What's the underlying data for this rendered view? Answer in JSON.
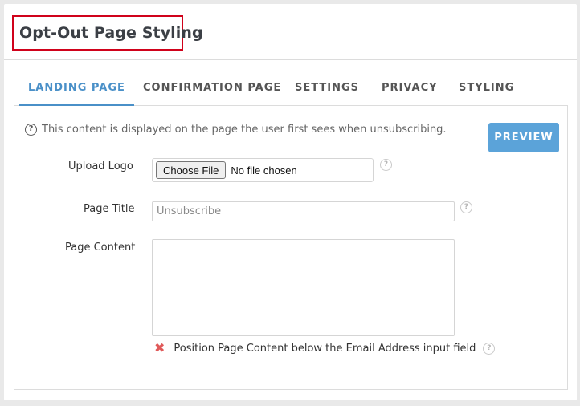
{
  "page": {
    "title": "Opt-Out Page Styling"
  },
  "tabs": [
    {
      "label": "LANDING PAGE",
      "active": true
    },
    {
      "label": "CONFIRMATION PAGE",
      "active": false
    },
    {
      "label": "SETTINGS",
      "active": false
    },
    {
      "label": "PRIVACY",
      "active": false
    },
    {
      "label": "STYLING",
      "active": false
    }
  ],
  "panel": {
    "info_text": "This content is displayed on the page the user first sees when unsubscribing.",
    "info_icon": "question-circle-icon",
    "preview_label": "PREVIEW",
    "upload_logo": {
      "label": "Upload Logo",
      "button_label": "Choose File",
      "status": "No file chosen"
    },
    "page_title": {
      "label": "Page Title",
      "placeholder": "Unsubscribe",
      "value": ""
    },
    "page_content": {
      "label": "Page Content",
      "value": ""
    },
    "position_option": {
      "label": "Position Page Content below the Email Address input field",
      "checked": false,
      "icon": "x-mark-icon"
    },
    "help_glyph": "?"
  },
  "colors": {
    "accent": "#4a90c8",
    "preview_button": "#5ba3d9",
    "title_highlight": "#d0021b",
    "x_mark": "#e05a5a"
  }
}
